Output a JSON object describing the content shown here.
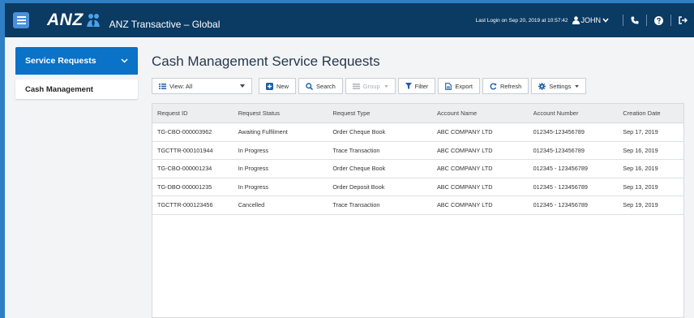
{
  "header": {
    "brand": "ANZ",
    "app_title": "ANZ Transactive – Global",
    "last_login": "Last Login on Sep 20, 2019 at 10:57:42",
    "user_name": "JOHN"
  },
  "sidebar": {
    "section_label": "Service Requests",
    "items": [
      {
        "label": "Cash Management"
      }
    ]
  },
  "main": {
    "title": "Cash Management Service Requests",
    "toolbar": {
      "view": "View: All",
      "new": "New",
      "search": "Search",
      "group": "Group",
      "filter": "Filter",
      "export": "Export",
      "refresh": "Refresh",
      "settings": "Settings"
    },
    "table": {
      "columns": [
        "Request ID",
        "Request Status",
        "Request Type",
        "Account Name",
        "Account Number",
        "Creation Date"
      ],
      "rows": [
        [
          "TG-CBO-000003962",
          "Awaiting Fulfilment",
          "Order Cheque Book",
          "ABC COMPANY LTD",
          "012345-123456789",
          "Sep 17, 2019"
        ],
        [
          "TGCTTR-000101944",
          "In Progress",
          "Trace Transaction",
          "ABC COMPANY LTD",
          "012345-123456789",
          "Sep 16, 2019"
        ],
        [
          "TG-CBO-000001234",
          "In Progress",
          "Order Cheque Book",
          "ABC COMPANY LTD",
          "012345 - 123456789",
          "Sep 16, 2019"
        ],
        [
          "TG-DBO-000001235",
          "In Progress",
          "Order Deposit Book",
          "ABC COMPANY LTD",
          "012345 - 123456789",
          "Sep 13, 2019"
        ],
        [
          "TGCTTR-000123456",
          "Cancelled",
          "Trace Transaction",
          "ABC COMPANY LTD",
          "012345 - 123456789",
          "Sep 19, 2019"
        ]
      ]
    }
  },
  "colors": {
    "header_bg": "#0b3a63",
    "accent": "#0a72c7",
    "page_bg": "#f3f4f6"
  }
}
